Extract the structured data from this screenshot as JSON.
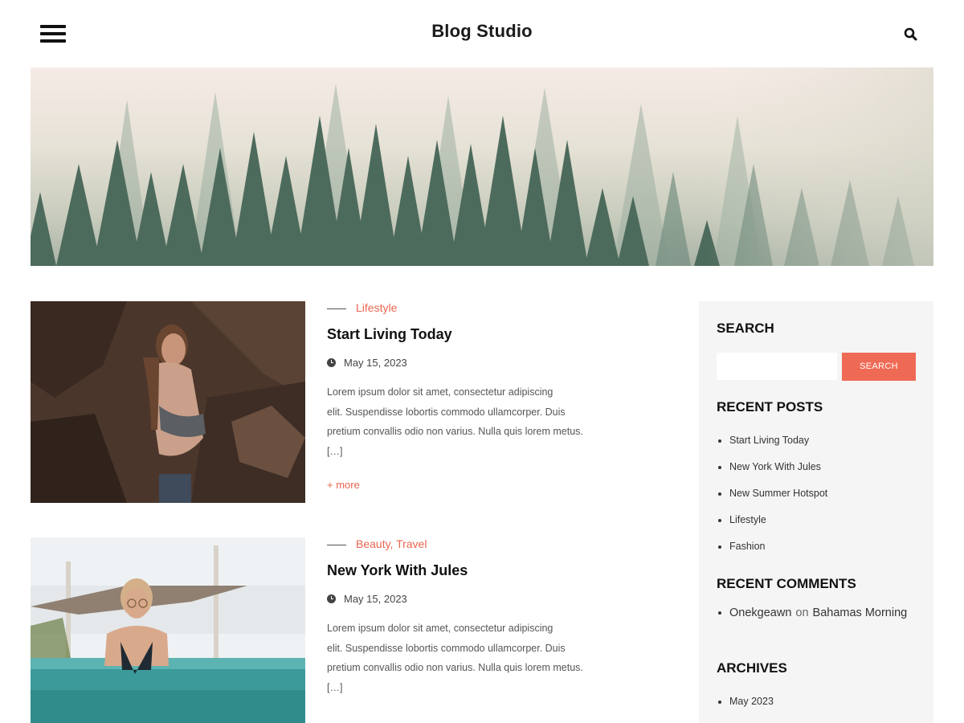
{
  "header": {
    "site_title": "Blog Studio",
    "menu_icon": "hamburger-menu-icon",
    "search_icon": "search-icon"
  },
  "hero": {
    "image": "misty-pine-forest-banner"
  },
  "posts": [
    {
      "categories": "Lifestyle",
      "title": "Start Living Today",
      "date": "May 15, 2023",
      "excerpt_lines": [
        "Lorem ipsum dolor sit amet, consectetur adipiscing",
        "elit. Suspendisse lobortis commodo ullamcorper. Duis",
        "pretium convallis odio non varius. Nulla quis lorem metus.",
        "[…]"
      ],
      "more_label": "+ more",
      "image": "woman-posing-by-rocks"
    },
    {
      "categories": "Beauty, Travel",
      "title": "New York With Jules",
      "date": "May 15, 2023",
      "excerpt_lines": [
        "Lorem ipsum dolor sit amet, consectetur adipiscing",
        "elit. Suspendisse lobortis commodo ullamcorper. Duis",
        "pretium convallis odio non varius. Nulla quis lorem metus.",
        "[…]"
      ],
      "image": "woman-in-pool-with-sunglasses"
    }
  ],
  "sidebar": {
    "search": {
      "title": "SEARCH",
      "placeholder": "",
      "value": "",
      "button_label": "SEARCH"
    },
    "recent_posts": {
      "title": "RECENT POSTS",
      "items": [
        "Start Living Today",
        "New York With Jules",
        "New Summer Hotspot",
        "Lifestyle",
        "Fashion"
      ]
    },
    "recent_comments": {
      "title": "RECENT COMMENTS",
      "author": "Onekgeawn",
      "on": "on",
      "post": "Bahamas Morning"
    },
    "archives": {
      "title": "ARCHIVES",
      "items": [
        "May 2023"
      ]
    }
  },
  "colors": {
    "accent": "#e9654f",
    "button": "#ef6a55",
    "sidebar_bg": "#f5f5f5"
  }
}
